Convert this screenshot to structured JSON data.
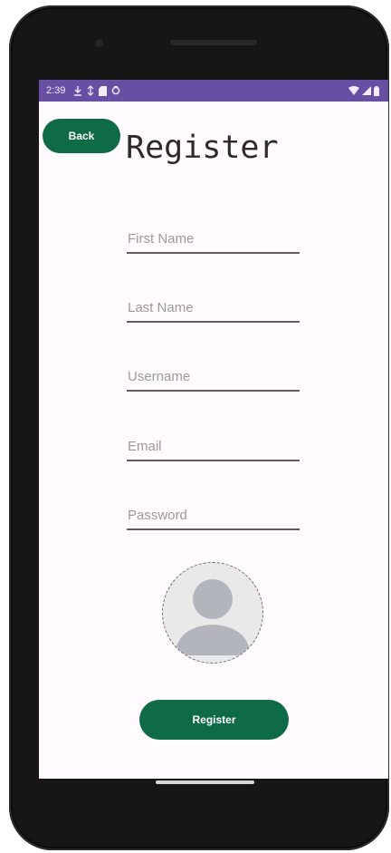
{
  "status_bar": {
    "time": "2:39",
    "icons": [
      "download-icon",
      "signal-activity-icon",
      "sd-card-icon",
      "circle-icon",
      "wifi-icon",
      "cellular-signal-icon",
      "battery-icon"
    ],
    "color": "#6750a4"
  },
  "header": {
    "back_label": "Back",
    "title": "Register"
  },
  "form": {
    "first_name": {
      "placeholder": "First Name",
      "value": ""
    },
    "last_name": {
      "placeholder": "Last Name",
      "value": ""
    },
    "username": {
      "placeholder": "Username",
      "value": ""
    },
    "email": {
      "placeholder": "Email",
      "value": ""
    },
    "password": {
      "placeholder": "Password",
      "value": ""
    }
  },
  "avatar": {
    "icon": "person-placeholder-icon"
  },
  "actions": {
    "register_label": "Register"
  },
  "colors": {
    "accent": "#0f6b45",
    "status_bar": "#6750a4",
    "screen_background": "#fffbfe"
  }
}
